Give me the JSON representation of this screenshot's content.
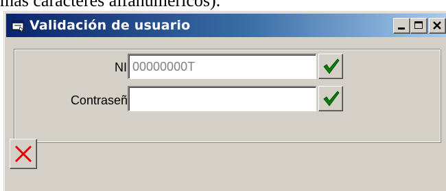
{
  "background_text": "más caracteres alfanuméricos).",
  "window": {
    "title": "Validación de usuario",
    "title_icon": "window-app-icon",
    "controls": {
      "minimize_icon": "minimize-icon",
      "maximize_icon": "maximize-icon",
      "close_icon": "close-icon"
    }
  },
  "form": {
    "nif_label": "NIF",
    "nif_value": "00000000T",
    "password_label": "Contraseña",
    "password_value": "",
    "confirm_icon": "checkmark-icon",
    "cancel_icon": "cancel-x-icon"
  },
  "colors": {
    "titlebar_start": "#0a246a",
    "titlebar_end": "#a6caf0",
    "window_face": "#d4d0c8",
    "check_green": "#008000",
    "cancel_red": "#e00000"
  }
}
